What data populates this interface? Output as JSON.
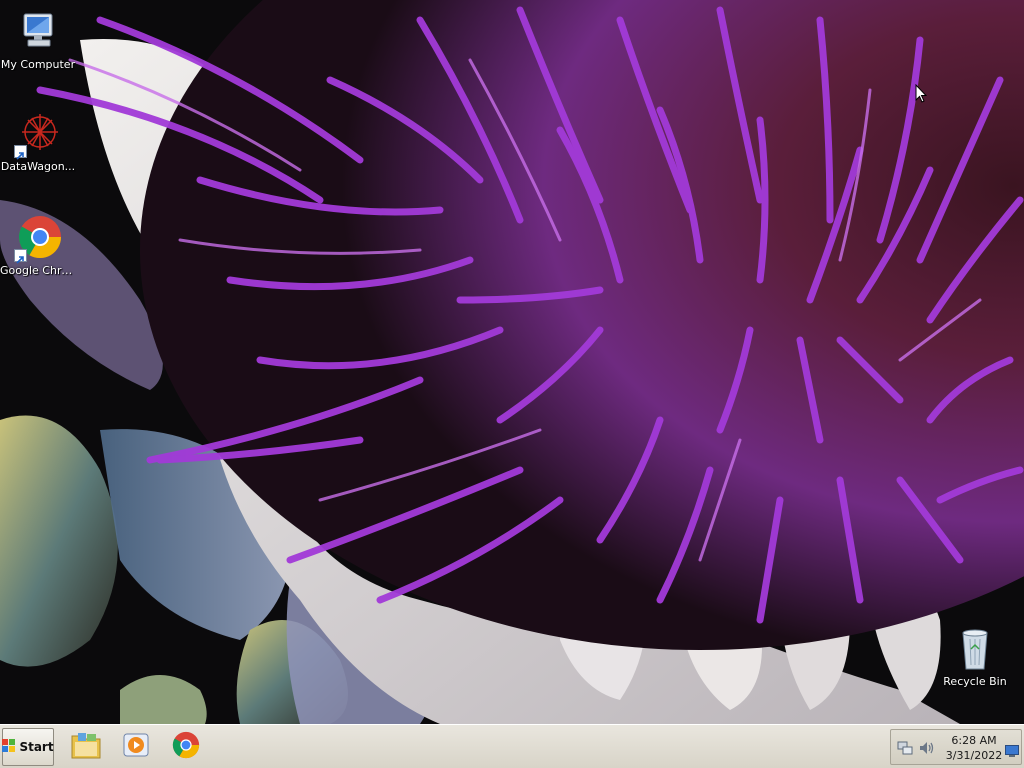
{
  "desktop": {
    "icons": [
      {
        "label": "My Computer",
        "icon": "computer-icon"
      },
      {
        "label": "DataWagon...",
        "icon": "datawagon-icon"
      },
      {
        "label": "Google Chrome",
        "icon": "chrome-icon"
      },
      {
        "label": "Recycle Bin",
        "icon": "recycle-bin-icon"
      }
    ],
    "wallpaper": "purple thistle flower macro"
  },
  "taskbar": {
    "start_label": "Start",
    "pinned": [
      {
        "icon": "file-explorer-icon"
      },
      {
        "icon": "media-player-icon"
      },
      {
        "icon": "chrome-icon"
      }
    ],
    "tray": {
      "icons": [
        "network-icon",
        "volume-icon"
      ],
      "time": "6:28 AM",
      "date": "3/31/2022"
    }
  },
  "colors": {
    "accent_purple": "#a23ad8",
    "taskbar_bg": "#dcd8cc"
  }
}
